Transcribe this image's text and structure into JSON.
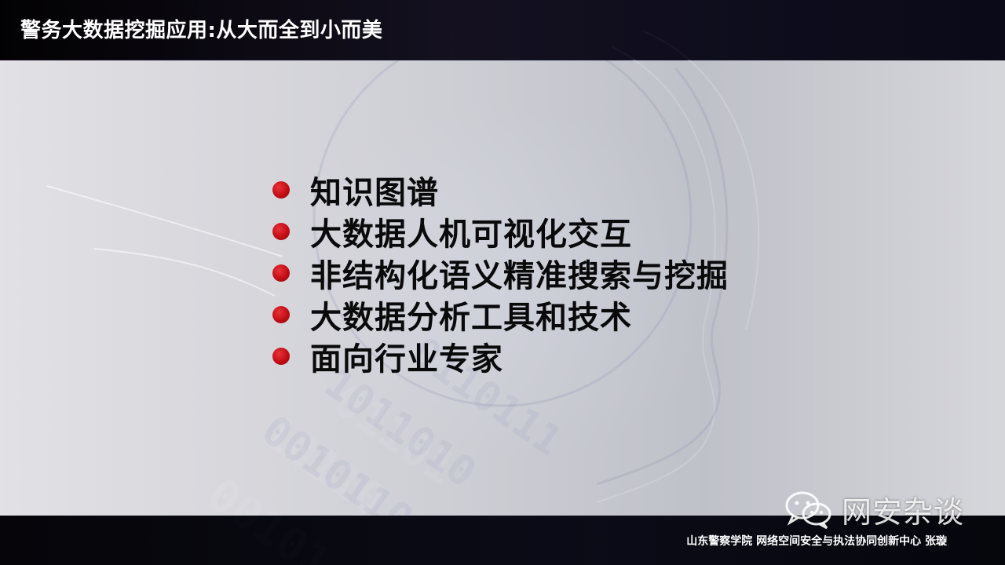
{
  "slide": {
    "title": "警务大数据挖掘应用:从大而全到小而美",
    "bullets": [
      "知识图谱",
      "大数据人机可视化交互",
      "非结构化语义精准搜索与挖掘",
      "大数据分析工具和技术",
      "面向行业专家"
    ],
    "bullet_color": "#c20d15",
    "footer": "山东警察学院 网络空间安全与执法协同创新中心 张璇"
  },
  "watermark": {
    "icon": "wechat-icon",
    "text": "网安杂谈"
  }
}
